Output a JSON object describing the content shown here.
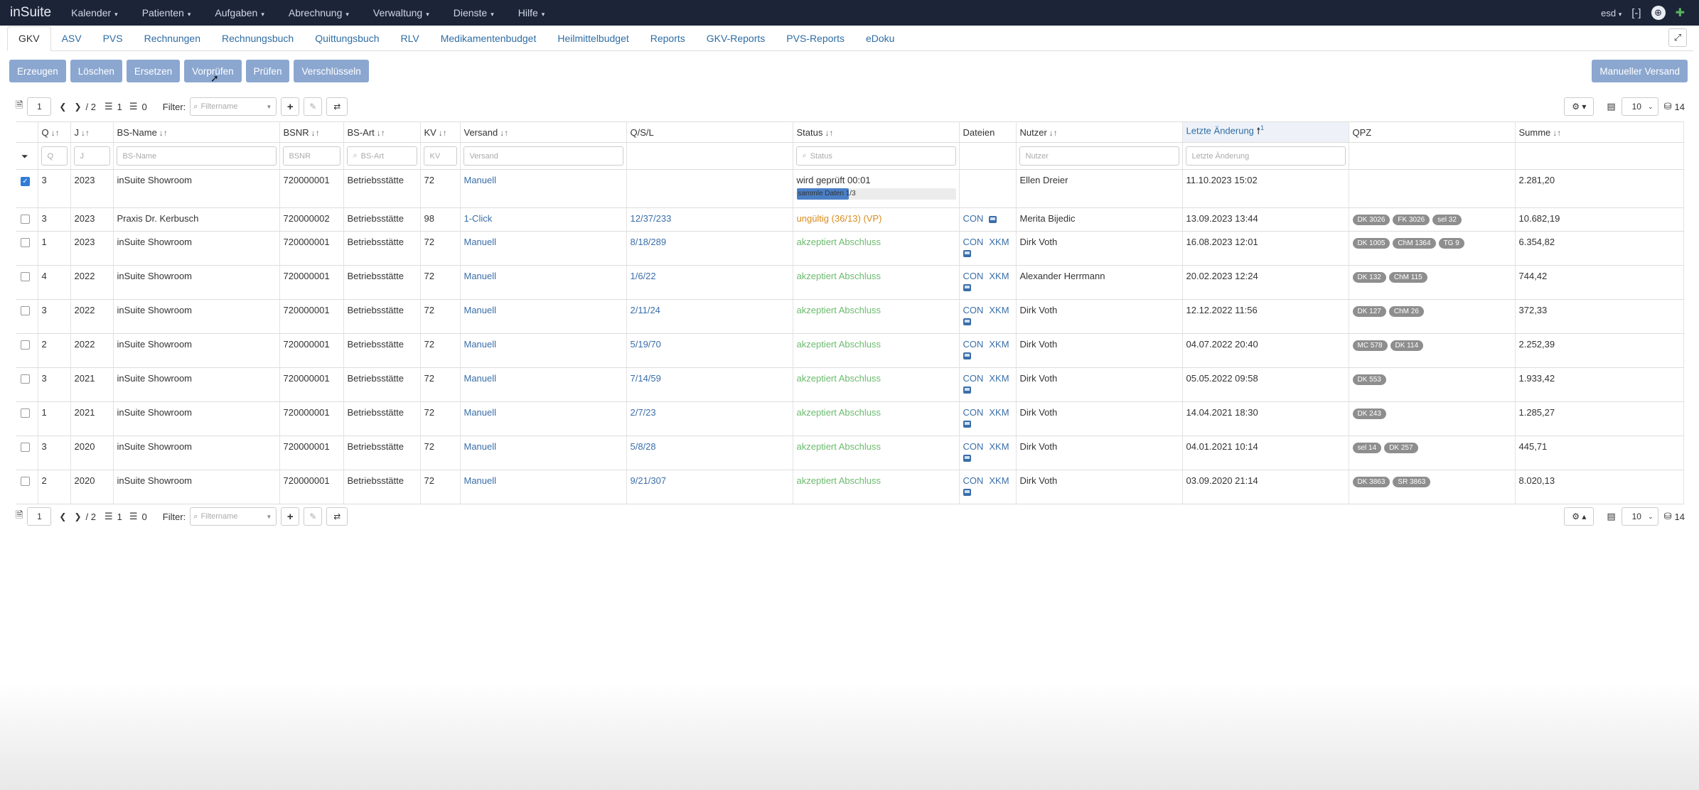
{
  "app": {
    "brand": "inSuite",
    "menu": [
      {
        "label": "Kalender"
      },
      {
        "label": "Patienten"
      },
      {
        "label": "Aufgaben"
      },
      {
        "label": "Abrechnung"
      },
      {
        "label": "Verwaltung"
      },
      {
        "label": "Dienste"
      },
      {
        "label": "Hilfe"
      }
    ],
    "user": "esd",
    "icons": [
      "caret-down-icon",
      "user-caret-icon",
      "bracket-icon",
      "globe-icon",
      "pin-icon"
    ]
  },
  "tabs": [
    "GKV",
    "ASV",
    "PVS",
    "Rechnungen",
    "Rechnungsbuch",
    "Quittungsbuch",
    "RLV",
    "Medikamentenbudget",
    "Heilmittelbudget",
    "Reports",
    "GKV-Reports",
    "PVS-Reports",
    "eDoku"
  ],
  "active_tab": "GKV",
  "actions": {
    "erzeugen": "Erzeugen",
    "loeschen": "Löschen",
    "ersetzen": "Ersetzen",
    "vorpruefen": "Vorprüfen",
    "pruefen": "Prüfen",
    "verschluesseln": "Verschlüsseln",
    "manueller_versand": "Manueller Versand"
  },
  "pager": {
    "page": "1",
    "total_pages": "/ 2",
    "count_a": "1",
    "count_b": "0",
    "filter_label": "Filter:",
    "filter_placeholder": "Filtername",
    "page_size": "10",
    "total": "14"
  },
  "columns": {
    "q": "Q",
    "j": "J",
    "bs_name": "BS-Name",
    "bsnr": "BSNR",
    "bs_art": "BS-Art",
    "kv": "KV",
    "versand": "Versand",
    "qsl": "Q/S/L",
    "status": "Status",
    "dateien": "Dateien",
    "nutzer": "Nutzer",
    "letzte_aenderung": "Letzte Änderung",
    "letzte_sort_index": "1",
    "qpz": "QPZ",
    "summe": "Summe"
  },
  "filters": {
    "q": "Q",
    "j": "J",
    "bs_name": "BS-Name",
    "bsnr": "BSNR",
    "bs_art": "BS-Art",
    "kv": "KV",
    "versand": "Versand",
    "status": "Status",
    "nutzer": "Nutzer",
    "letzte_aenderung": "Letzte Änderung"
  },
  "rows": [
    {
      "checked": true,
      "q": "3",
      "j": "2023",
      "bs_name": "inSuite Showroom",
      "bsnr": "720000001",
      "bs_art": "Betriebsstätte",
      "kv": "72",
      "versand": "Manuell",
      "qsl": "",
      "status": "wird geprüft 00:01",
      "status_type": "progress",
      "progress_text": "sammle Daten 1/3",
      "progress": 0.33,
      "files": [],
      "disk": false,
      "nutzer": "Ellen Dreier",
      "letzte": "11.10.2023 15:02",
      "qpz": [],
      "summe": "2.281,20"
    },
    {
      "checked": false,
      "q": "3",
      "j": "2023",
      "bs_name": "Praxis Dr. Kerbusch",
      "bsnr": "720000002",
      "bs_art": "Betriebsstätte",
      "kv": "98",
      "versand": "1-Click",
      "qsl": "12/37/233",
      "status": "ungültig (36/13) (VP)",
      "status_type": "warn",
      "files": [
        "CON"
      ],
      "disk": true,
      "disk_inline": true,
      "nutzer": "Merita Bijedic",
      "letzte": "13.09.2023 13:44",
      "qpz": [
        "DK 3026",
        "FK 3026",
        "sel 32"
      ],
      "summe": "10.682,19"
    },
    {
      "checked": false,
      "q": "1",
      "j": "2023",
      "bs_name": "inSuite Showroom",
      "bsnr": "720000001",
      "bs_art": "Betriebsstätte",
      "kv": "72",
      "versand": "Manuell",
      "qsl": "8/18/289",
      "status": "akzeptiert Abschluss",
      "status_type": "ok",
      "files": [
        "CON",
        "XKM"
      ],
      "disk": true,
      "nutzer": "Dirk Voth",
      "letzte": "16.08.2023 12:01",
      "qpz": [
        "DK 1005",
        "ChM 1364",
        "TG 9"
      ],
      "summe": "6.354,82"
    },
    {
      "checked": false,
      "q": "4",
      "j": "2022",
      "bs_name": "inSuite Showroom",
      "bsnr": "720000001",
      "bs_art": "Betriebsstätte",
      "kv": "72",
      "versand": "Manuell",
      "qsl": "1/6/22",
      "status": "akzeptiert Abschluss",
      "status_type": "ok",
      "files": [
        "CON",
        "XKM"
      ],
      "disk": true,
      "nutzer": "Alexander Herrmann",
      "letzte": "20.02.2023 12:24",
      "qpz": [
        "DK 132",
        "ChM 115"
      ],
      "summe": "744,42"
    },
    {
      "checked": false,
      "q": "3",
      "j": "2022",
      "bs_name": "inSuite Showroom",
      "bsnr": "720000001",
      "bs_art": "Betriebsstätte",
      "kv": "72",
      "versand": "Manuell",
      "qsl": "2/11/24",
      "status": "akzeptiert Abschluss",
      "status_type": "ok",
      "files": [
        "CON",
        "XKM"
      ],
      "disk": true,
      "nutzer": "Dirk Voth",
      "letzte": "12.12.2022 11:56",
      "qpz": [
        "DK 127",
        "ChM 26"
      ],
      "summe": "372,33"
    },
    {
      "checked": false,
      "q": "2",
      "j": "2022",
      "bs_name": "inSuite Showroom",
      "bsnr": "720000001",
      "bs_art": "Betriebsstätte",
      "kv": "72",
      "versand": "Manuell",
      "qsl": "5/19/70",
      "status": "akzeptiert Abschluss",
      "status_type": "ok",
      "files": [
        "CON",
        "XKM"
      ],
      "disk": true,
      "nutzer": "Dirk Voth",
      "letzte": "04.07.2022 20:40",
      "qpz": [
        "MC 578",
        "DK 114"
      ],
      "summe": "2.252,39"
    },
    {
      "checked": false,
      "q": "3",
      "j": "2021",
      "bs_name": "inSuite Showroom",
      "bsnr": "720000001",
      "bs_art": "Betriebsstätte",
      "kv": "72",
      "versand": "Manuell",
      "qsl": "7/14/59",
      "status": "akzeptiert Abschluss",
      "status_type": "ok",
      "files": [
        "CON",
        "XKM"
      ],
      "disk": true,
      "nutzer": "Dirk Voth",
      "letzte": "05.05.2022 09:58",
      "qpz": [
        "DK 553"
      ],
      "summe": "1.933,42"
    },
    {
      "checked": false,
      "q": "1",
      "j": "2021",
      "bs_name": "inSuite Showroom",
      "bsnr": "720000001",
      "bs_art": "Betriebsstätte",
      "kv": "72",
      "versand": "Manuell",
      "qsl": "2/7/23",
      "status": "akzeptiert Abschluss",
      "status_type": "ok",
      "files": [
        "CON",
        "XKM"
      ],
      "disk": true,
      "nutzer": "Dirk Voth",
      "letzte": "14.04.2021 18:30",
      "qpz": [
        "DK 243"
      ],
      "summe": "1.285,27"
    },
    {
      "checked": false,
      "q": "3",
      "j": "2020",
      "bs_name": "inSuite Showroom",
      "bsnr": "720000001",
      "bs_art": "Betriebsstätte",
      "kv": "72",
      "versand": "Manuell",
      "qsl": "5/8/28",
      "status": "akzeptiert Abschluss",
      "status_type": "ok",
      "files": [
        "CON",
        "XKM"
      ],
      "disk": true,
      "nutzer": "Dirk Voth",
      "letzte": "04.01.2021 10:14",
      "qpz": [
        "sel 14",
        "DK 257"
      ],
      "summe": "445,71"
    },
    {
      "checked": false,
      "q": "2",
      "j": "2020",
      "bs_name": "inSuite Showroom",
      "bsnr": "720000001",
      "bs_art": "Betriebsstätte",
      "kv": "72",
      "versand": "Manuell",
      "qsl": "9/21/307",
      "status": "akzeptiert Abschluss",
      "status_type": "ok",
      "files": [
        "CON",
        "XKM"
      ],
      "disk": true,
      "nutzer": "Dirk Voth",
      "letzte": "03.09.2020 21:14",
      "qpz": [
        "DK 3863",
        "SR 3863"
      ],
      "summe": "8.020,13"
    }
  ],
  "colors": {
    "navbar": "#1c2438",
    "action_button": "#8ba7d0",
    "link": "#3a6ea8",
    "status_ok": "#6cbb6e",
    "status_warn": "#d88c1e",
    "badge": "#8e8e8e",
    "progress": "#4a7fc6"
  }
}
